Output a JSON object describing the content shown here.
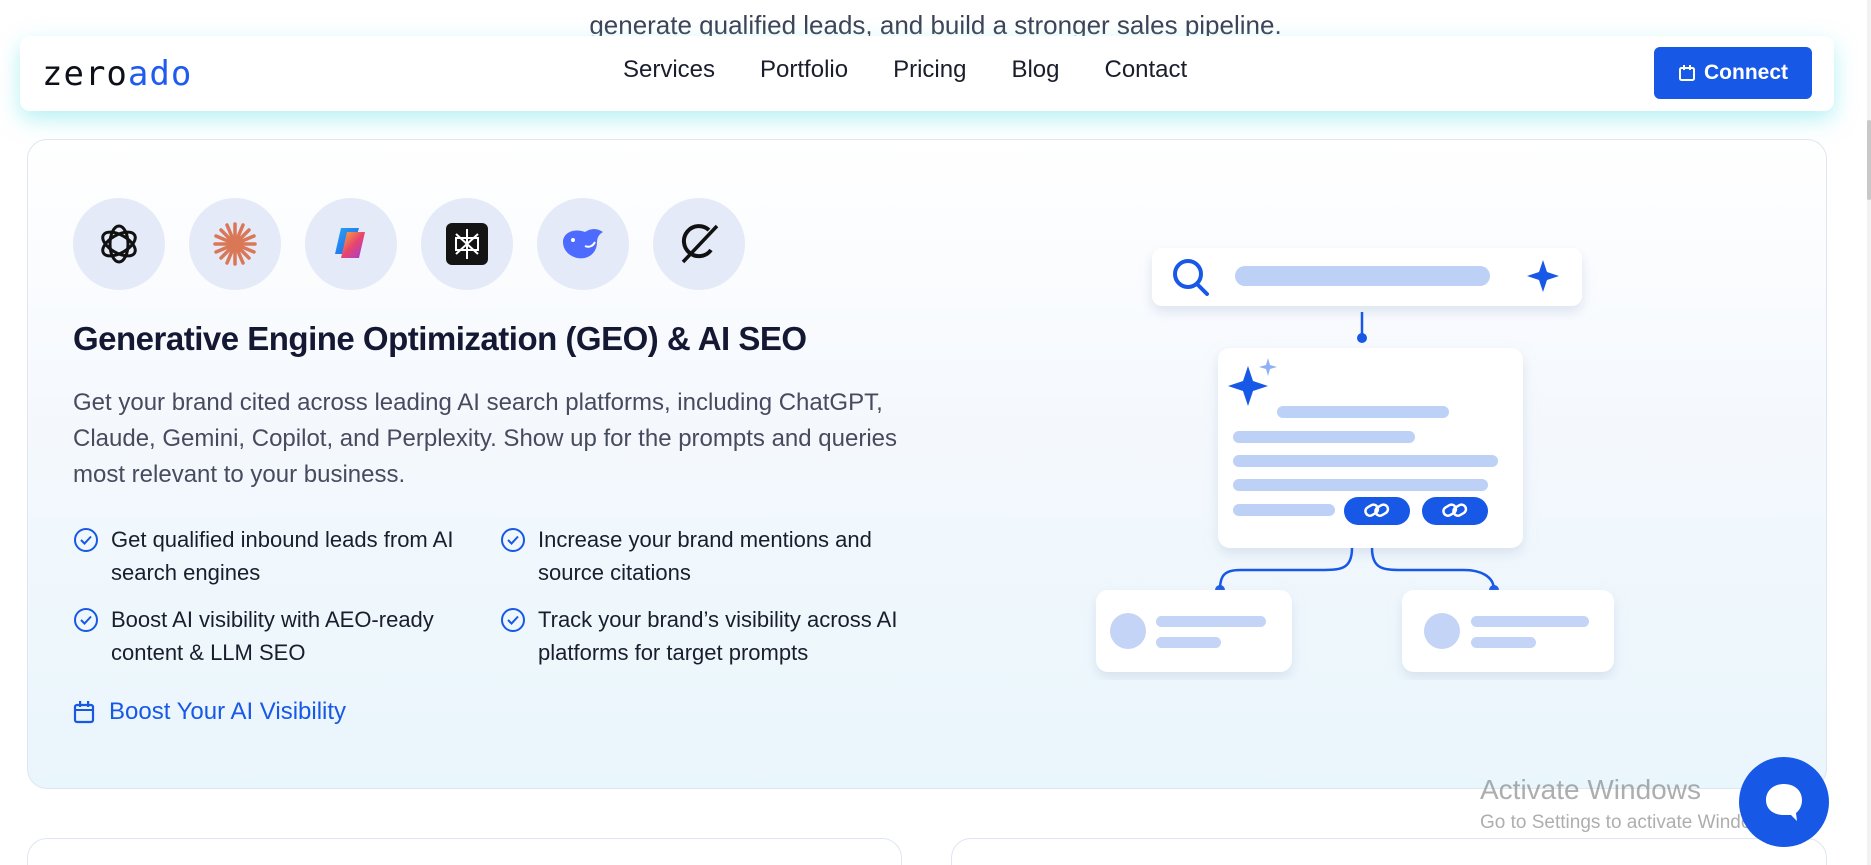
{
  "background_text": "generate qualified leads, and build a stronger sales pipeline.",
  "navbar": {
    "logo_dark": "zero",
    "logo_blue": "ado",
    "links": [
      "Services",
      "Portfolio",
      "Pricing",
      "Blog",
      "Contact"
    ],
    "connect_label": "Connect"
  },
  "hero": {
    "ai_icons": [
      "chatgpt-icon",
      "claude-icon",
      "copilot-icon",
      "perplexity-icon",
      "deepseek-icon",
      "grok-icon"
    ],
    "title": "Generative Engine Optimization (GEO) & AI SEO",
    "description": "Get your brand cited across leading AI search platforms, including ChatGPT, Claude, Gemini, Copilot, and Perplexity. Show up for the prompts and queries most relevant to your business.",
    "features": [
      "Get qualified inbound leads from AI search engines",
      "Increase your brand mentions and source citations",
      "Boost AI visibility with AEO-ready content & LLM SEO",
      "Track your brand’s visibility across AI platforms for target prompts"
    ],
    "cta_label": "Boost Your AI Visibility"
  },
  "watermark": {
    "line1": "Activate Windows",
    "line2": "Go to Settings to activate Windows."
  },
  "colors": {
    "accent": "#1758e6",
    "title": "#141833",
    "body_text": "#474b5e",
    "icon_bg": "#e5eaf8"
  }
}
